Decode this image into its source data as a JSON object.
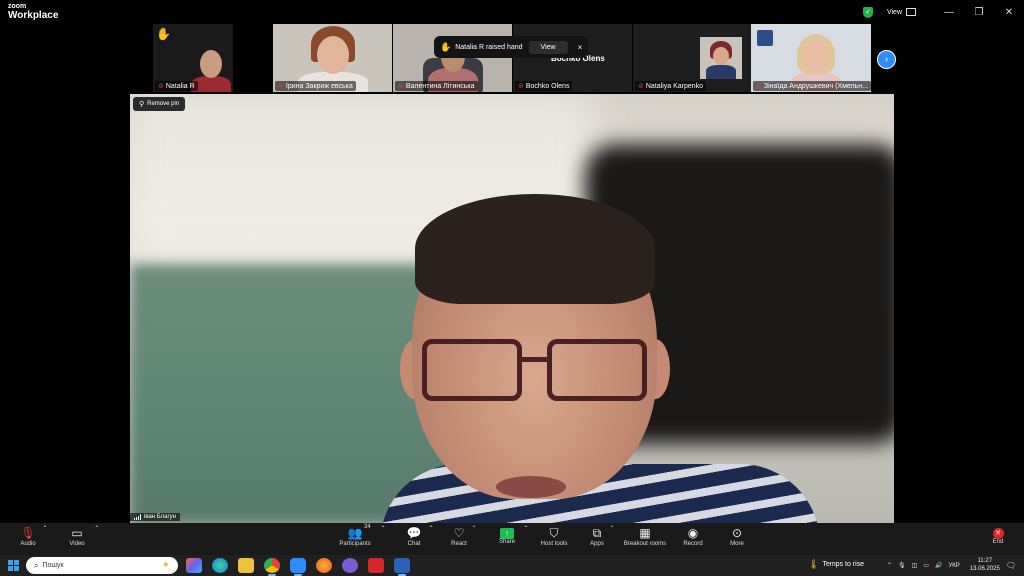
{
  "app": {
    "logo_small": "zoom",
    "logo_big": "Workplace",
    "view_label": "View",
    "window_controls": [
      "—",
      "❐",
      "✕"
    ]
  },
  "thumbnails": [
    {
      "name": "Natalia R",
      "muted": true,
      "hand_raised": true
    },
    {
      "name": "Ірина Закриж евська",
      "muted": true
    },
    {
      "name": "Валентина Літинська",
      "muted": true
    },
    {
      "name": "Bochko Olens",
      "muted": true,
      "card_text": "Bochko Olens"
    },
    {
      "name": "Nataliya Karpenko",
      "muted": true
    },
    {
      "name": "Зінаїда Андрушкевич (Хмельн...",
      "muted": true
    }
  ],
  "notification": {
    "text": "Natalia R raised hand",
    "view_label": "View",
    "close": "×"
  },
  "main_video": {
    "remove_pin_label": "Remove pin",
    "speaker_name": "іван Благун"
  },
  "toolbar": {
    "audio": "Audio",
    "video": "Video",
    "participants": "Participants",
    "participants_count": "34",
    "chat": "Chat",
    "react": "React",
    "share": "Share",
    "host_tools": "Host tools",
    "apps": "Apps",
    "breakout_rooms": "Breakout rooms",
    "record": "Record",
    "more": "More",
    "end": "End"
  },
  "taskbar": {
    "search_placeholder": "Пошук",
    "weather_text": "Temps to rise",
    "language": "УКР",
    "time": "11:27",
    "date": "13.06.2025"
  },
  "colors": {
    "accent_blue": "#2d8cff",
    "share_green": "#1ebc52",
    "end_red": "#e02828",
    "shield_green": "#1fb34a",
    "hand_yellow": "#f6c342"
  },
  "icons": {
    "hand": "✋",
    "mic_off": "🎙",
    "pin": "📌",
    "next": "›"
  }
}
